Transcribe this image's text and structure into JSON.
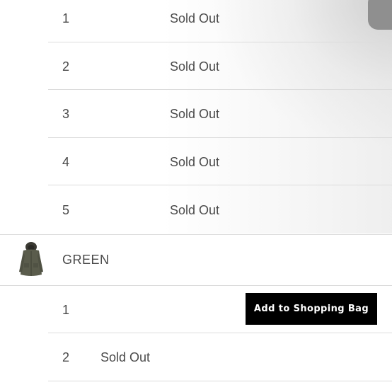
{
  "group1": {
    "rows": [
      {
        "size": "1",
        "status": "Sold Out"
      },
      {
        "size": "2",
        "status": "Sold Out"
      },
      {
        "size": "3",
        "status": "Sold Out"
      },
      {
        "size": "4",
        "status": "Sold Out"
      },
      {
        "size": "5",
        "status": "Sold Out"
      }
    ]
  },
  "color_option": {
    "name": "GREEN",
    "thumbnail_icon": "parka-jacket-thumbnail"
  },
  "group2": {
    "rows": [
      {
        "size": "1",
        "action": "Add to Shopping Bag"
      },
      {
        "size": "2",
        "status": "Sold Out"
      }
    ]
  }
}
